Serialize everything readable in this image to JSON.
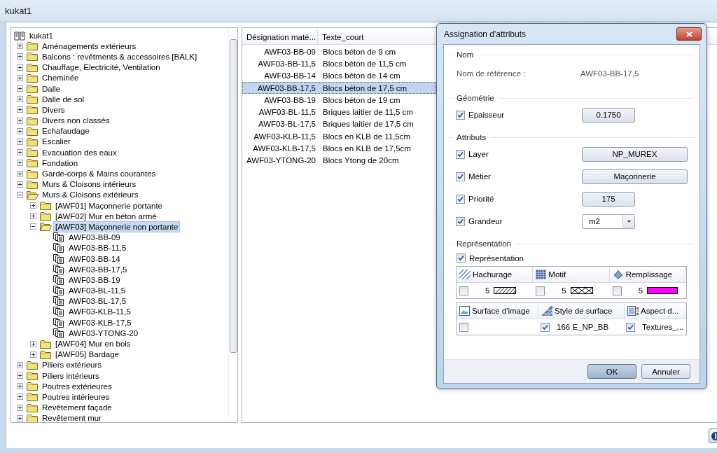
{
  "window": {
    "title": "kukat1"
  },
  "tree": {
    "label": "kukat1",
    "kind": "catalog",
    "selected": false,
    "children": [
      {
        "label": "Aménagements extérieurs",
        "kind": "folder",
        "expanded": false,
        "selected": false
      },
      {
        "label": "Balcons : revêtments & accessoires [BALK]",
        "kind": "folder",
        "expanded": false,
        "selected": false
      },
      {
        "label": "Chauffage, Electricité, Ventilation",
        "kind": "folder",
        "expanded": false,
        "selected": false
      },
      {
        "label": "Cheminée",
        "kind": "folder",
        "expanded": false,
        "selected": false
      },
      {
        "label": "Dalle",
        "kind": "folder",
        "expanded": false,
        "selected": false
      },
      {
        "label": "Dalle de sol",
        "kind": "folder",
        "expanded": false,
        "selected": false
      },
      {
        "label": "Divers",
        "kind": "folder",
        "expanded": false,
        "selected": false
      },
      {
        "label": "Divers non classés",
        "kind": "folder",
        "expanded": false,
        "selected": false
      },
      {
        "label": "Echafaudage",
        "kind": "folder",
        "expanded": false,
        "selected": false
      },
      {
        "label": "Escalier",
        "kind": "folder",
        "expanded": false,
        "selected": false
      },
      {
        "label": "Evacuation des eaux",
        "kind": "folder",
        "expanded": false,
        "selected": false
      },
      {
        "label": "Fondation",
        "kind": "folder",
        "expanded": false,
        "selected": false
      },
      {
        "label": "Garde-corps & Mains courantes",
        "kind": "folder",
        "expanded": false,
        "selected": false
      },
      {
        "label": "Murs & Cloisons intérieurs",
        "kind": "folder",
        "expanded": false,
        "selected": false
      },
      {
        "label": "Murs & Cloisons extérieurs",
        "kind": "folder",
        "expanded": true,
        "selected": false,
        "children": [
          {
            "label": "[AWF01] Maçonnerie portante",
            "kind": "folder",
            "expanded": false,
            "selected": false
          },
          {
            "label": "[AWF02] Mur en béton armé",
            "kind": "folder",
            "expanded": false,
            "selected": false
          },
          {
            "label": "[AWF03] Maçonnerie non portante",
            "kind": "folder",
            "expanded": true,
            "selected": true,
            "children": [
              {
                "label": "AWF03-BB-09",
                "kind": "material",
                "selected": false
              },
              {
                "label": "AWF03-BB-11,5",
                "kind": "material",
                "selected": false
              },
              {
                "label": "AWF03-BB-14",
                "kind": "material",
                "selected": false
              },
              {
                "label": "AWF03-BB-17,5",
                "kind": "material",
                "selected": false
              },
              {
                "label": "AWF03-BB-19",
                "kind": "material",
                "selected": false
              },
              {
                "label": "AWF03-BL-11,5",
                "kind": "material",
                "selected": false
              },
              {
                "label": "AWF03-BL-17,5",
                "kind": "material",
                "selected": false
              },
              {
                "label": "AWF03-KLB-11,5",
                "kind": "material",
                "selected": false
              },
              {
                "label": "AWF03-KLB-17,5",
                "kind": "material",
                "selected": false
              },
              {
                "label": "AWF03-YTONG-20",
                "kind": "material",
                "selected": false
              }
            ]
          },
          {
            "label": "[AWF04] Mur en bois",
            "kind": "folder",
            "expanded": false,
            "selected": false
          },
          {
            "label": "[AWF05] Bardage",
            "kind": "folder",
            "expanded": false,
            "selected": false
          }
        ]
      },
      {
        "label": "Piliers extérieurs",
        "kind": "folder",
        "expanded": false,
        "selected": false
      },
      {
        "label": "Piliers intérieurs",
        "kind": "folder",
        "expanded": false,
        "selected": false
      },
      {
        "label": "Poutres extérieures",
        "kind": "folder",
        "expanded": false,
        "selected": false
      },
      {
        "label": "Poutres intérieures",
        "kind": "folder",
        "expanded": false,
        "selected": false
      },
      {
        "label": "Revêtement façade",
        "kind": "folder",
        "expanded": false,
        "selected": false
      },
      {
        "label": "Revêtement mur",
        "kind": "folder",
        "expanded": false,
        "selected": false
      }
    ]
  },
  "table": {
    "columns": [
      "Désignation maté...",
      "Texte_court"
    ],
    "rows": [
      {
        "cells": [
          "AWF03-BB-09",
          "Blocs béton de 9 cm"
        ],
        "selected": false
      },
      {
        "cells": [
          "AWF03-BB-11,5",
          "Blocs béton de 11,5 cm"
        ],
        "selected": false
      },
      {
        "cells": [
          "AWF03-BB-14",
          "Blocs béton de 14 cm"
        ],
        "selected": false
      },
      {
        "cells": [
          "AWF03-BB-17,5",
          "Blocs béton de 17,5 cm"
        ],
        "selected": true
      },
      {
        "cells": [
          "AWF03-BB-19",
          "Blocs béton de 19 cm"
        ],
        "selected": false
      },
      {
        "cells": [
          "AWF03-BL-11,5",
          "Briques laitier de 11,5 cm"
        ],
        "selected": false
      },
      {
        "cells": [
          "AWF03-BL-17,5",
          "Briques laitier de 17,5 cm"
        ],
        "selected": false
      },
      {
        "cells": [
          "AWF03-KLB-11,5",
          "Blocs en KLB de 11,5cm"
        ],
        "selected": false
      },
      {
        "cells": [
          "AWF03-KLB-17,5",
          "Blocs en KLB de 17,5cm"
        ],
        "selected": false
      },
      {
        "cells": [
          "AWF03-YTONG-20",
          "Blocs Ytong de 20cm"
        ],
        "selected": false
      }
    ]
  },
  "dialog": {
    "title": "Assignation d'attributs",
    "name_section": {
      "title": "Nom",
      "label": "Nom de référence :",
      "value": "AWF03-BB-17,5"
    },
    "geometry_section": {
      "title": "Géométrie",
      "rows": [
        {
          "label": "Epaisseur",
          "checked": true,
          "kind": "button",
          "value": "0.1750"
        }
      ]
    },
    "attributes_section": {
      "title": "Attributs",
      "rows": [
        {
          "label": "Layer",
          "checked": true,
          "kind": "widebutton",
          "value": "NP_MUREX"
        },
        {
          "label": "Métier",
          "checked": true,
          "kind": "widebutton",
          "value": "Maçonnerie"
        },
        {
          "label": "Priorité",
          "checked": true,
          "kind": "button",
          "value": "175"
        },
        {
          "label": "Grandeur",
          "checked": true,
          "kind": "dropdown",
          "value": "m2"
        }
      ]
    },
    "representation_section": {
      "title": "Représentation",
      "label": "Représentation",
      "checked": true,
      "grids": [
        {
          "headers": [
            "Hachurage",
            "Motif",
            "Remplissage"
          ],
          "cells": [
            {
              "checked": false,
              "value": "5",
              "kind": "hatch"
            },
            {
              "checked": false,
              "value": "5",
              "kind": "cross"
            },
            {
              "checked": false,
              "value": "5",
              "kind": "solid",
              "color": "#ff00ff"
            }
          ]
        },
        {
          "headers": [
            "Surface d'image",
            "Style de surface",
            "Aspect d..."
          ],
          "cells": [
            {
              "checked": false
            },
            {
              "checked": true,
              "value": "166 E_NP_BB"
            },
            {
              "checked": true,
              "value": "Textures_..."
            }
          ]
        }
      ]
    },
    "buttons": [
      {
        "label": "OK",
        "default": true
      },
      {
        "label": "Annuler",
        "default": false
      }
    ]
  }
}
